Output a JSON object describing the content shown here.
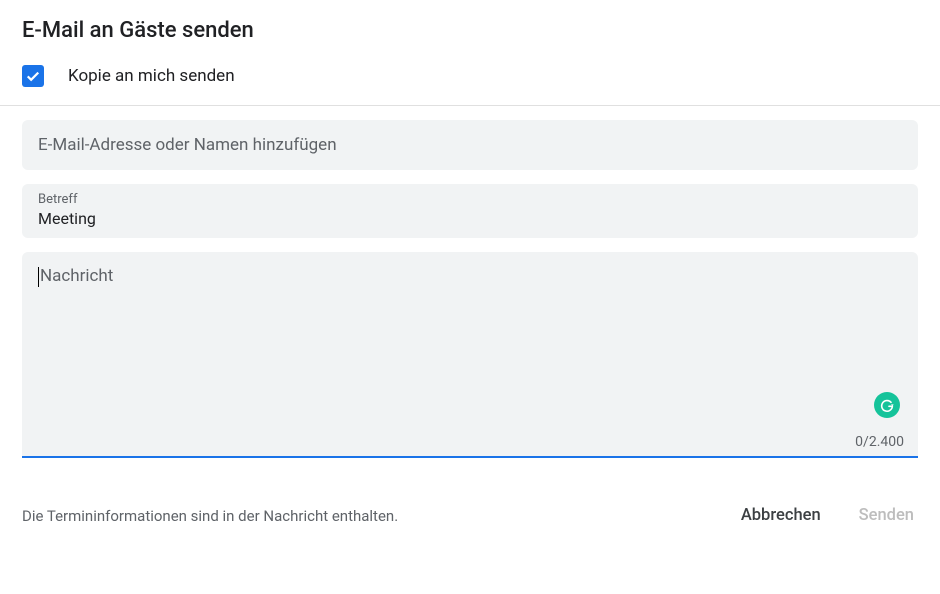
{
  "dialog": {
    "title": "E-Mail an Gäste senden",
    "copy_to_self": {
      "checked": true,
      "label": "Kopie an mich senden"
    },
    "fields": {
      "recipients": {
        "placeholder": "E-Mail-Adresse oder Namen hinzufügen",
        "value": ""
      },
      "subject": {
        "label": "Betreff",
        "value": "Meeting"
      },
      "message": {
        "placeholder": "Nachricht",
        "value": "",
        "char_count": "0",
        "char_limit": "2.400"
      }
    },
    "footer": {
      "note": "Die Termininformationen sind in der Nachricht enthalten.",
      "cancel_label": "Abbrechen",
      "send_label": "Senden"
    },
    "icons": {
      "grammarly": "G"
    }
  }
}
